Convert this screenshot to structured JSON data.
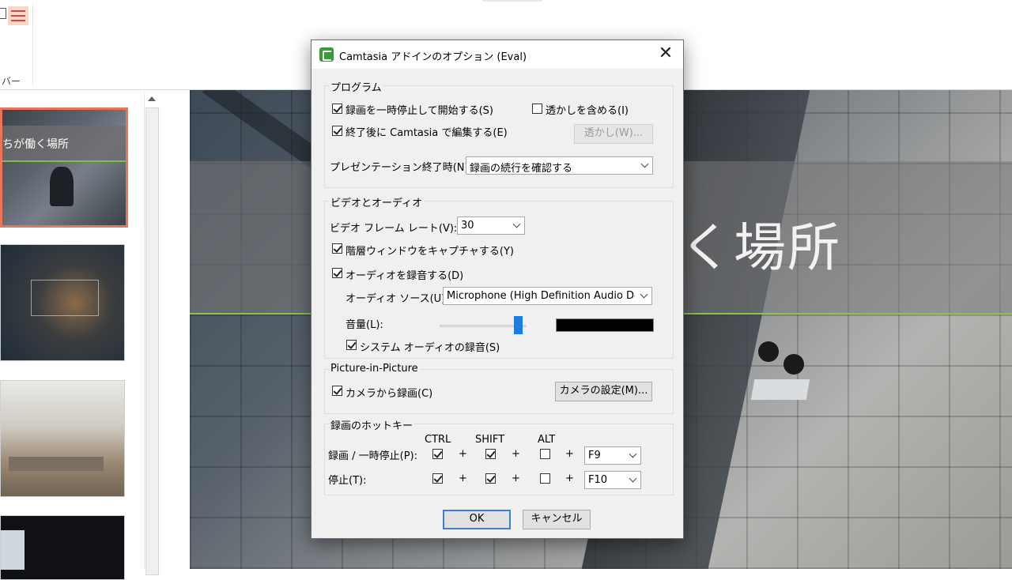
{
  "background": {
    "ribbon_group_label": "バー",
    "slide_thumb_title": "ちが働く場所",
    "slide_title": "く場所"
  },
  "dialog": {
    "title": "Camtasia アドインのオプション (Eval)",
    "close_glyph": "✕",
    "program": {
      "label": "プログラム",
      "pause_start": {
        "label": "録画を一時停止して開始する(S)",
        "checked": true
      },
      "watermark": {
        "label": "透かしを含める(I)",
        "checked": false
      },
      "edit_after": {
        "label": "終了後に Camtasia で編集する(E)",
        "checked": true
      },
      "watermark_button": "透かし(W)...",
      "presentation_end_label": "プレゼンテーション終了時(N):",
      "presentation_end_value": "録画の続行を確認する"
    },
    "video_audio": {
      "label": "ビデオとオーディオ",
      "framerate_label": "ビデオ フレーム レート(V):",
      "framerate_value": "30",
      "layered": {
        "label": "階層ウィンドウをキャプチャする(Y)",
        "checked": true
      },
      "record_audio": {
        "label": "オーディオを録音する(D)",
        "checked": true
      },
      "source_label": "オーディオ ソース(U):",
      "source_value": "Microphone (High Definition Audio Device)",
      "volume_label": "音量(L):",
      "volume_level": 0.86,
      "system_audio": {
        "label": "システム オーディオの録音(S)",
        "checked": true
      }
    },
    "pip": {
      "label": "Picture-in-Picture",
      "camera": {
        "label": "カメラから録画(C)",
        "checked": true
      },
      "camera_settings_button": "カメラの設定(M)..."
    },
    "hotkeys": {
      "label": "録画のホットキー",
      "col_ctrl": "CTRL",
      "col_shift": "SHIFT",
      "col_alt": "ALT",
      "plus": "+",
      "rows": [
        {
          "label": "録画 / 一時停止(P):",
          "ctrl": true,
          "shift": true,
          "alt": false,
          "key": "F9"
        },
        {
          "label": "停止(T):",
          "ctrl": true,
          "shift": true,
          "alt": false,
          "key": "F10"
        }
      ]
    },
    "ok": "OK",
    "cancel": "キャンセル"
  }
}
